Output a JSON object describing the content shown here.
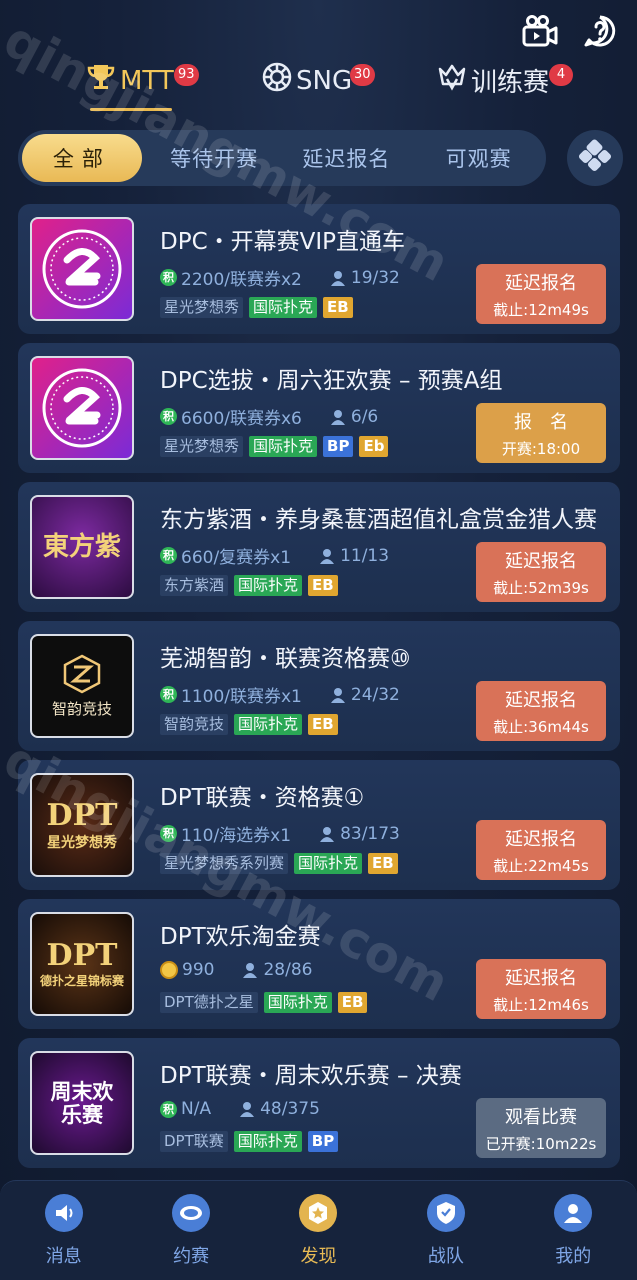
{
  "top_icons": [
    "video-camera-icon",
    "chat-bubble-icon"
  ],
  "tabs": [
    {
      "label": "MTT",
      "badge": "93",
      "icon": "trophy-icon",
      "active": true
    },
    {
      "label": "SNG",
      "badge": "30",
      "icon": "chip-icon"
    },
    {
      "label": "训练赛",
      "badge": "4",
      "icon": "crown-icon"
    }
  ],
  "filters": [
    "全部",
    "等待开赛",
    "延迟报名",
    "可观赛"
  ],
  "cards": [
    {
      "title": "DPC・开幕赛VIP直通车",
      "prize": "2200/联赛券x2",
      "count": "19/32",
      "org": "星光梦想秀",
      "tag_green": "国际扑克",
      "badge": "EB",
      "btn1": "延迟报名",
      "btn2": "截止:12m49s"
    },
    {
      "title": "DPC选拔・周六狂欢赛 – 预赛A组",
      "prize": "6600/联赛券x6",
      "count": "6/6",
      "org": "星光梦想秀",
      "tag_green": "国际扑克",
      "badge": "BP",
      "badge2": "Eb",
      "btn1": "报名",
      "btn2": "开赛:18:00"
    },
    {
      "title": "东方紫酒・养身桑葚酒超值礼盒赏金猎人赛",
      "prize": "660/复赛券x1",
      "count": "11/13",
      "org": "东方紫酒",
      "tag_green": "国际扑克",
      "badge": "EB",
      "btn1": "延迟报名",
      "btn2": "截止:52m39s",
      "logo": "東方紫"
    },
    {
      "title": "芜湖智韵・联赛资格赛⑩",
      "prize": "1100/联赛券x1",
      "count": "24/32",
      "org": "智韵竞技",
      "tag_green": "国际扑克",
      "badge": "EB",
      "btn1": "延迟报名",
      "btn2": "截止:36m44s",
      "logo": "智韵竞技"
    },
    {
      "title": "DPT联赛・资格赛①",
      "prize": "110/海选券x1",
      "count": "83/173",
      "org": "星光梦想秀系列赛",
      "tag_green": "国际扑克",
      "badge": "EB",
      "btn1": "延迟报名",
      "btn2": "截止:22m45s",
      "logo": "DPT",
      "logo2": "星光梦想秀"
    },
    {
      "title": "DPT欢乐淘金赛",
      "prize": "990",
      "count": "28/86",
      "org": "DPT德扑之星",
      "tag_green": "国际扑克",
      "badge": "EB",
      "btn1": "延迟报名",
      "btn2": "截止:12m46s",
      "logo": "DPT",
      "logo2": "德扑之星锦标赛"
    },
    {
      "title": "DPT联赛・周末欢乐赛 – 决赛",
      "prize": "N/A",
      "count": "48/375",
      "org": "DPT联赛",
      "tag_green": "国际扑克",
      "badge": "BP",
      "btn1": "观看比赛",
      "btn2": "已开赛:10m22s",
      "logo": "周末欢乐赛"
    }
  ],
  "nav": [
    {
      "label": "消息",
      "icon": "speaker-icon"
    },
    {
      "label": "约赛",
      "icon": "table-icon"
    },
    {
      "label": "发现",
      "icon": "discover-star-icon",
      "active": true
    },
    {
      "label": "战队",
      "icon": "shield-icon"
    },
    {
      "label": "我的",
      "icon": "user-icon"
    }
  ],
  "watermark": "qingjiangmw.com",
  "colors": {
    "accent_gold": "#e8b84e",
    "late_reg": "#d97258",
    "register": "#dca049",
    "watch": "#5b6b82",
    "badge_red": "#e03a45"
  }
}
